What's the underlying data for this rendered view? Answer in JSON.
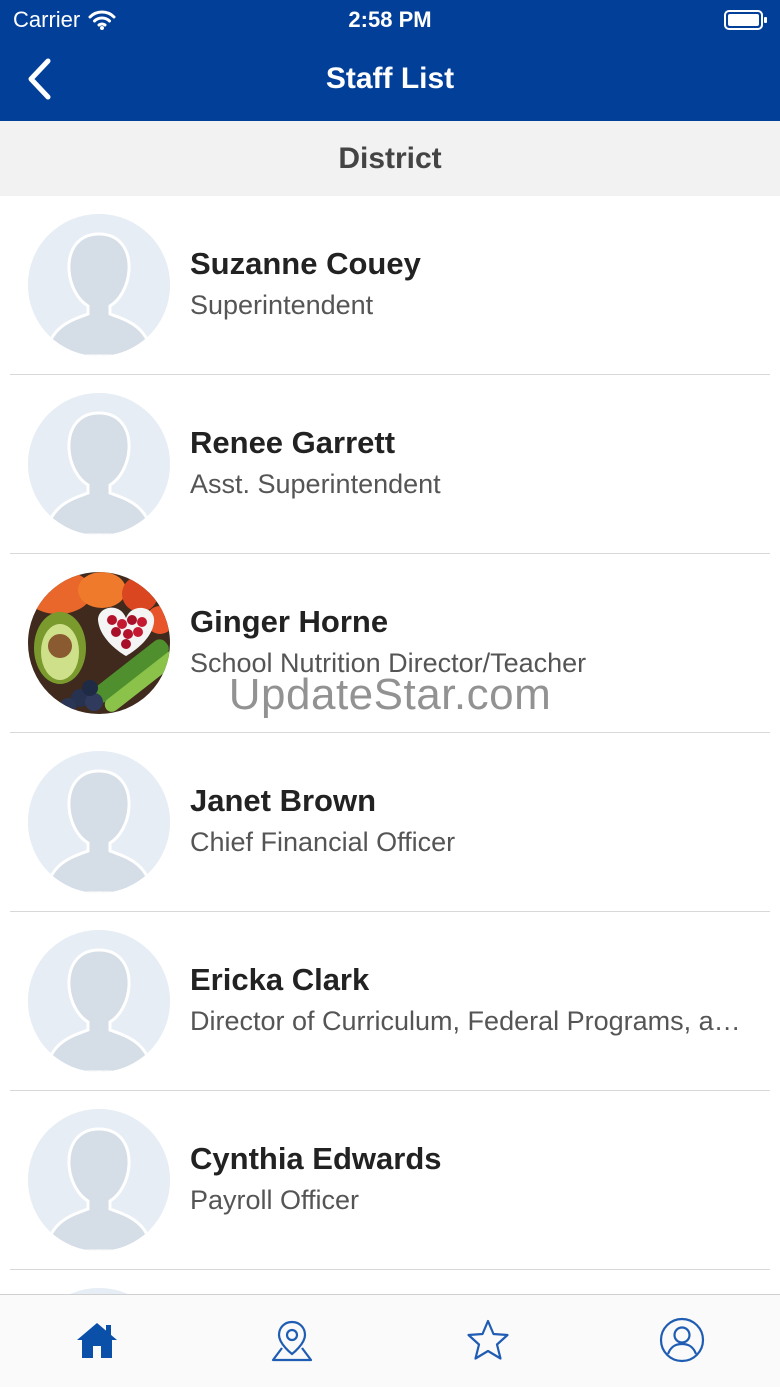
{
  "status_bar": {
    "carrier": "Carrier",
    "time": "2:58 PM"
  },
  "nav": {
    "title": "Staff List",
    "back_icon": "chevron-left-icon"
  },
  "section": {
    "title": "District"
  },
  "staff": [
    {
      "name": "Suzanne Couey",
      "role": "Superintendent",
      "photo": "default-avatar"
    },
    {
      "name": "Renee Garrett",
      "role": "Asst. Superintendent",
      "photo": "default-avatar"
    },
    {
      "name": "Ginger Horne",
      "role": "School Nutrition Director/Teacher",
      "photo": "healthy-food-photo"
    },
    {
      "name": "Janet Brown",
      "role": "Chief Financial Officer",
      "photo": "default-avatar"
    },
    {
      "name": "Ericka Clark",
      "role": "Director of Curriculum, Federal Programs, a…",
      "photo": "default-avatar"
    },
    {
      "name": "Cynthia Edwards",
      "role": "Payroll Officer",
      "photo": "default-avatar"
    }
  ],
  "watermark": "UpdateStar.com",
  "tab_bar": {
    "icons": [
      "home-icon",
      "map-pin-icon",
      "star-icon",
      "profile-icon"
    ],
    "active": "home-icon"
  },
  "colors": {
    "brand": "#023f99",
    "active_tab": "#0a4fa8",
    "inactive_tab": "#1f5cb3"
  }
}
